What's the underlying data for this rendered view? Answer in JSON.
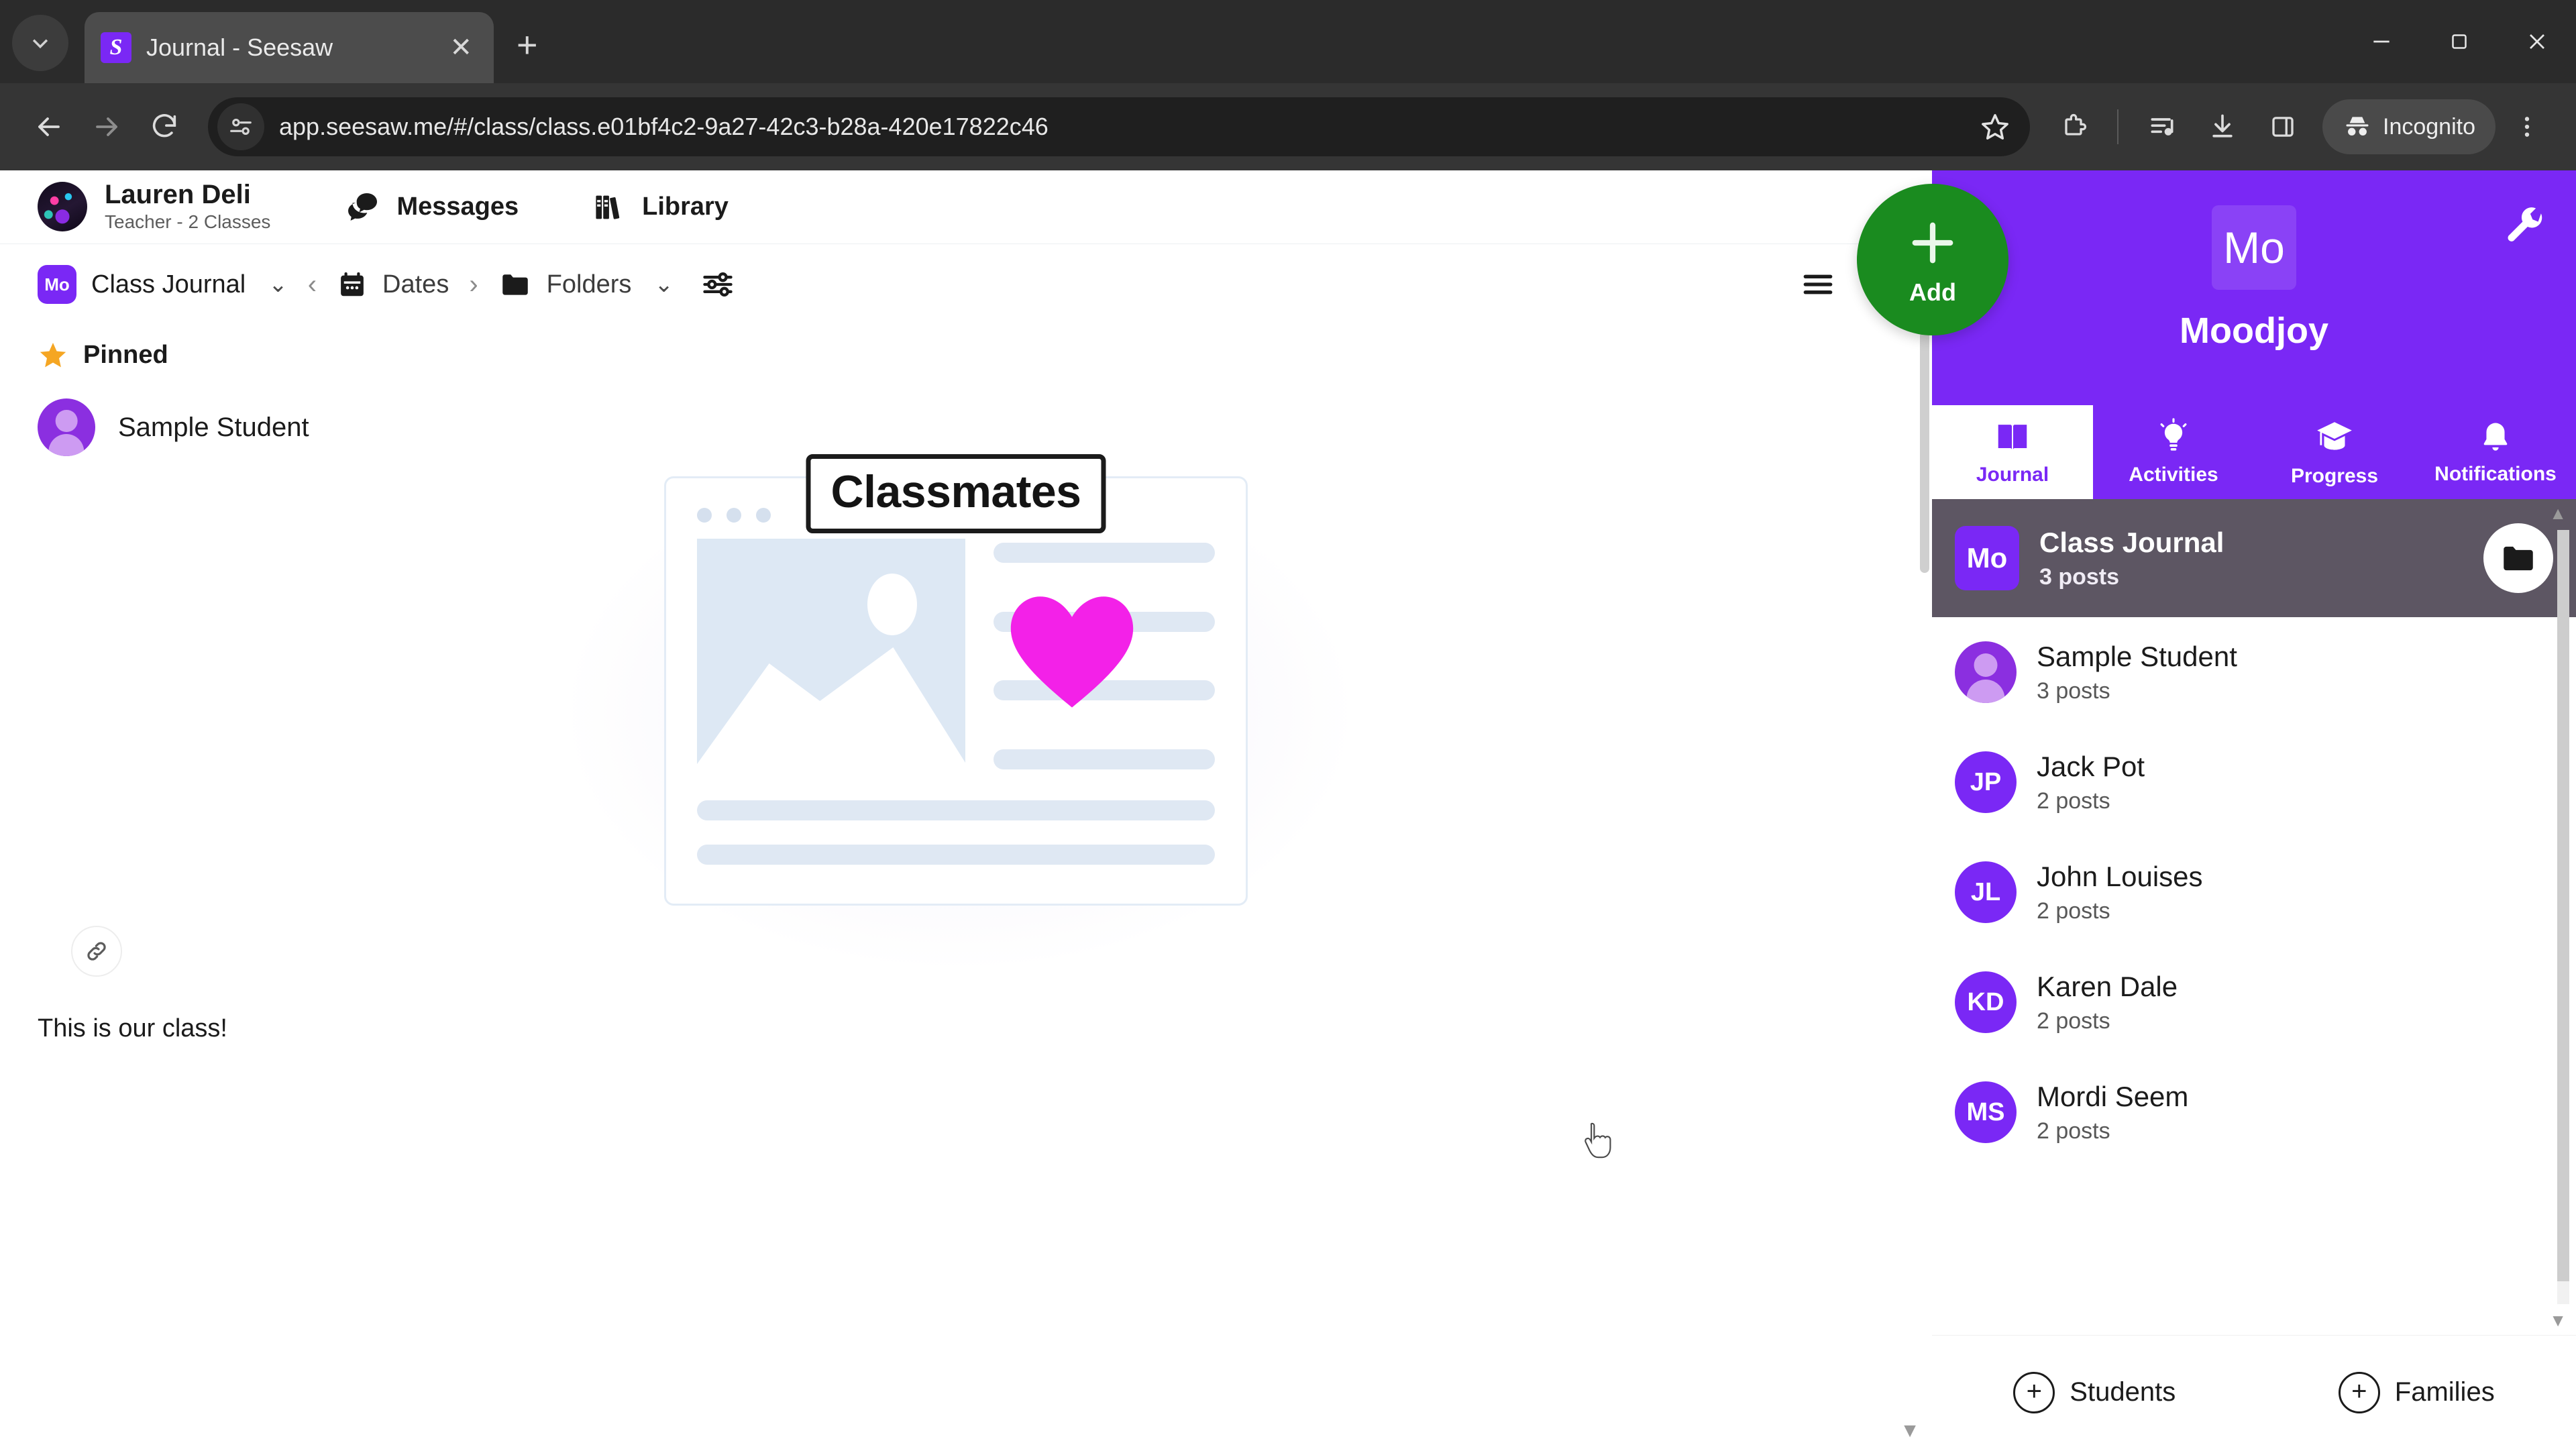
{
  "browser": {
    "tab": {
      "title": "Journal - Seesaw",
      "favicon_letter": "S",
      "close_label": "✕"
    },
    "new_tab_label": "+",
    "url": "app.seesaw.me/#/class/class.e01bf4c2-9a27-42c3-b28a-420e17822c46",
    "profile_label": "Incognito",
    "icons": {
      "tab_list": "chevron-down-icon",
      "back": "back-arrow-icon",
      "forward": "forward-arrow-icon",
      "reload": "reload-icon",
      "site_info": "site-settings-icon",
      "bookmark": "star-icon",
      "extensions": "extensions-icon",
      "reading_list": "reading-list-icon",
      "downloads": "download-icon",
      "side_panel": "side-panel-icon",
      "incognito": "incognito-icon",
      "menu": "three-dot-menu-icon",
      "minimize": "minimize-icon",
      "maximize": "maximize-icon",
      "close": "close-icon"
    }
  },
  "app_header": {
    "teacher_name": "Lauren Deli",
    "teacher_role": "Teacher - 2 Classes",
    "messages_label": "Messages",
    "library_label": "Library"
  },
  "toolbar": {
    "class_badge": "Mo",
    "class_label": "Class Journal",
    "caret": "⌄",
    "prev_arrow": "‹",
    "dates_label": "Dates",
    "next_arrow": "›",
    "folders_label": "Folders",
    "folders_caret": "⌄",
    "filter_icon": "filters-icon",
    "list_view_icon": "list-view-icon",
    "calendar_view_icon": "calendar-view-icon"
  },
  "feed": {
    "pinned_label": "Pinned",
    "pinned_star": "★",
    "post_author": "Sample Student",
    "post_art_title": "Classmates",
    "post_caption": "This is our class!",
    "link_button_icon": "link-icon",
    "colors": {
      "arrow": "#2fd2f4",
      "heart": "#f321e8",
      "thumb_bg": "#dde8f4"
    }
  },
  "sidebar": {
    "add_button_label": "Add",
    "class_initials": "Mo",
    "class_name": "Moodjoy",
    "settings_icon": "wrench-icon",
    "tabs": [
      {
        "label": "Journal",
        "icon": "book-icon",
        "active": true
      },
      {
        "label": "Activities",
        "icon": "lightbulb-icon",
        "active": false
      },
      {
        "label": "Progress",
        "icon": "graduation-cap-icon",
        "active": false
      },
      {
        "label": "Notifications",
        "icon": "bell-icon",
        "active": false
      }
    ],
    "journal_item": {
      "badge": "Mo",
      "title": "Class Journal",
      "subtitle": "3 posts",
      "folder_icon": "folder-icon"
    },
    "students": [
      {
        "initials": "",
        "name": "Sample Student",
        "posts": "3 posts",
        "generic": true
      },
      {
        "initials": "JP",
        "name": "Jack Pot",
        "posts": "2 posts",
        "generic": false
      },
      {
        "initials": "JL",
        "name": "John Louises",
        "posts": "2 posts",
        "generic": false
      },
      {
        "initials": "KD",
        "name": "Karen Dale",
        "posts": "2 posts",
        "generic": false
      },
      {
        "initials": "MS",
        "name": "Mordi Seem",
        "posts": "2 posts",
        "generic": false
      }
    ],
    "footer": {
      "students_label": "Students",
      "families_label": "Families",
      "plus": "+"
    }
  },
  "colors": {
    "brand_purple": "#7a28f5",
    "add_green": "#1a8b1f",
    "chrome_dark": "#353535"
  }
}
